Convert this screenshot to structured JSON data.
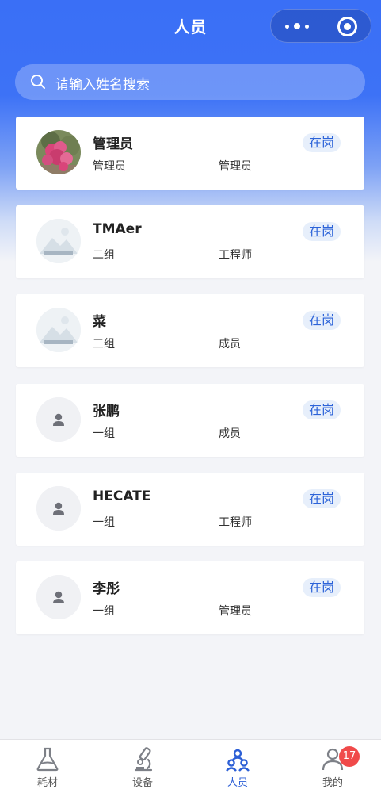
{
  "navbar": {
    "title": "人员"
  },
  "search": {
    "placeholder": "请输入姓名搜索"
  },
  "people": [
    {
      "name": "管理员",
      "group": "管理员",
      "role": "管理员",
      "status": "在岗",
      "avatar": "photo-flowers"
    },
    {
      "name": "TMAer",
      "group": "二组",
      "role": "工程师",
      "status": "在岗",
      "avatar": "image-placeholder"
    },
    {
      "name": "菜",
      "group": "三组",
      "role": "成员",
      "status": "在岗",
      "avatar": "image-placeholder"
    },
    {
      "name": "张鹏",
      "group": "一组",
      "role": "成员",
      "status": "在岗",
      "avatar": "default-user"
    },
    {
      "name": "HECATE",
      "group": "一组",
      "role": "工程师",
      "status": "在岗",
      "avatar": "default-user"
    },
    {
      "name": "李彤",
      "group": "一组",
      "role": "管理员",
      "status": "在岗",
      "avatar": "default-user"
    }
  ],
  "tabbar": {
    "items": [
      {
        "label": "耗材",
        "icon": "flask-icon"
      },
      {
        "label": "设备",
        "icon": "microscope-icon"
      },
      {
        "label": "人员",
        "icon": "people-icon",
        "active": true
      },
      {
        "label": "我的",
        "icon": "user-icon",
        "badge": "17"
      }
    ]
  },
  "colors": {
    "primary": "#3a6ff6",
    "badge_text": "#2c63d8",
    "badge_bg": "#e7effb",
    "alert": "#f04a4a"
  }
}
